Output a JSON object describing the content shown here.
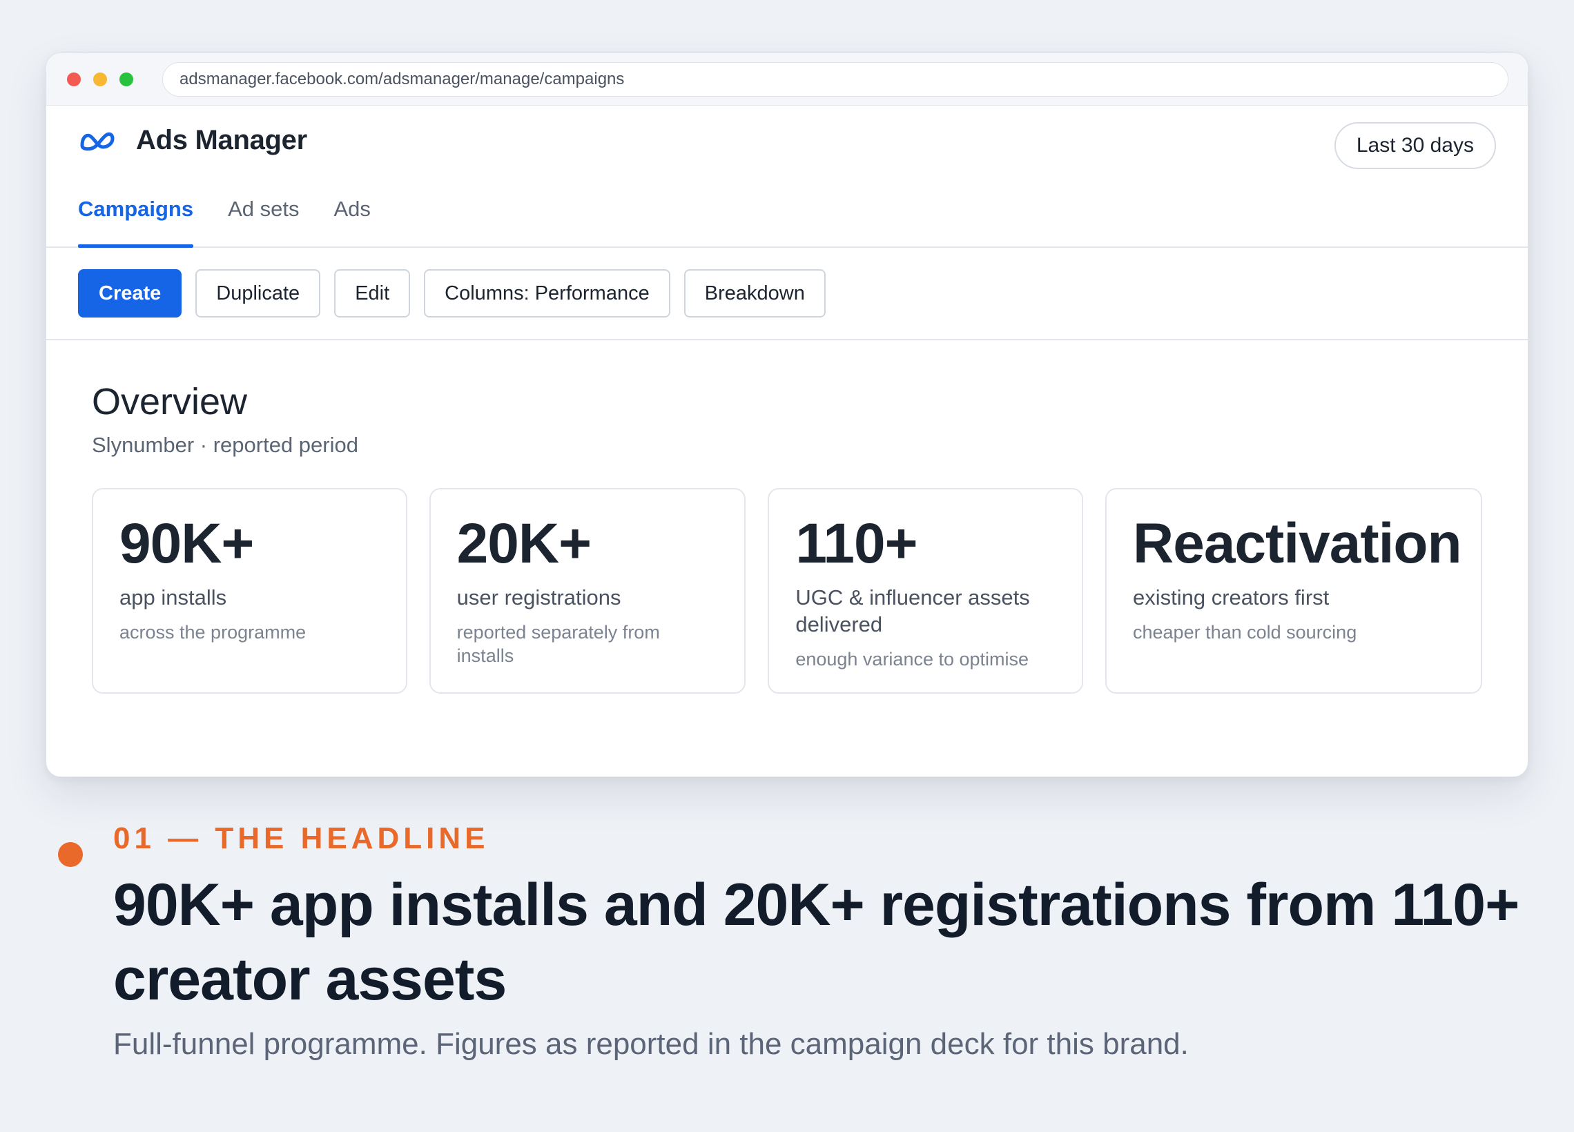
{
  "browser": {
    "url": "adsmanager.facebook.com/adsmanager/manage/campaigns"
  },
  "app": {
    "title": "Ads Manager",
    "date_range": "Last 30 days",
    "accent_color": "#1565e6"
  },
  "tabs": [
    {
      "label": "Campaigns",
      "active": true
    },
    {
      "label": "Ad sets",
      "active": false
    },
    {
      "label": "Ads",
      "active": false
    }
  ],
  "toolbar": {
    "create": "Create",
    "duplicate": "Duplicate",
    "edit": "Edit",
    "columns": "Columns: Performance",
    "breakdown": "Breakdown"
  },
  "overview": {
    "title": "Overview",
    "subtitle": "Slynumber · reported period",
    "cards": [
      {
        "value": "90K+",
        "label": "app installs",
        "note": "across the programme"
      },
      {
        "value": "20K+",
        "label": "user registrations",
        "note": "reported separately from installs"
      },
      {
        "value": "110+",
        "label": "UGC & influencer assets delivered",
        "note": "enough variance to optimise"
      },
      {
        "value": "Reactivation",
        "label": "existing creators first",
        "note": "cheaper than cold sourcing"
      }
    ]
  },
  "caption": {
    "eyebrow": "01 — THE HEADLINE",
    "headline": "90K+ app installs and 20K+ registrations from 110+ creator assets",
    "subline": "Full-funnel programme. Figures as reported in the campaign deck for this brand.",
    "accent_color": "#e8692a"
  }
}
